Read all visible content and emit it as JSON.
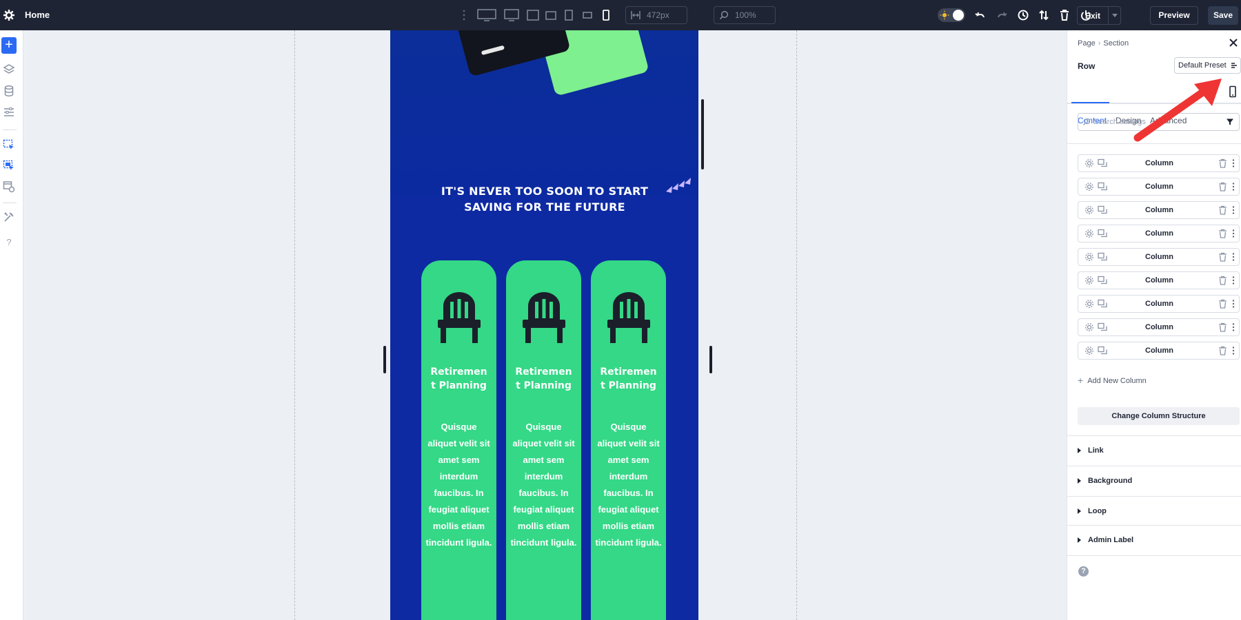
{
  "topbar": {
    "page_name": "Home",
    "width_value": "472px",
    "zoom_value": "100%",
    "exit_label": "Exit",
    "preview_label": "Preview",
    "save_label": "Save",
    "icons": [
      "settings-icon",
      "more-vertical-icon",
      "desktop-wide-icon",
      "desktop-icon",
      "laptop-icon",
      "tablet-landscape-icon",
      "tablet-icon",
      "phone-landscape-icon",
      "phone-icon",
      "width-icon",
      "zoom-icon",
      "theme-toggle",
      "undo-icon",
      "redo-icon",
      "history-icon",
      "sort-icon",
      "trash-icon",
      "power-icon"
    ]
  },
  "left_toolbar": {
    "help": "?",
    "icons": [
      "add-icon",
      "layers-icon",
      "database-icon",
      "sliders-icon",
      "select-icon",
      "multi-select-icon",
      "page-settings-icon",
      "tools-icon",
      "help-icon"
    ]
  },
  "canvas": {
    "headline": "IT'S NEVER TOO SOON TO START SAVING FOR THE FUTURE",
    "columns": [
      {
        "title": "Retiremen t Planning",
        "body": "Quisque aliquet velit sit amet sem interdum faucibus. In feugiat aliquet mollis etiam tincidunt ligula."
      },
      {
        "title": "Retiremen t Planning",
        "body": "Quisque aliquet velit sit amet sem interdum faucibus. In feugiat aliquet mollis etiam tincidunt ligula."
      },
      {
        "title": "Retiremen t Planning",
        "body": "Quisque aliquet velit sit amet sem interdum faucibus. In feugiat aliquet mollis etiam tincidunt ligula."
      }
    ],
    "colors": {
      "page_bg": "#0d2aa3",
      "column_bg": "#34d886",
      "accent_card": "#7ef08f"
    }
  },
  "panel": {
    "breadcrumb": [
      "Page",
      "Section"
    ],
    "element_label": "Row",
    "preset_label": "Default Preset",
    "tabs": [
      "Content",
      "Design",
      "Advanced"
    ],
    "active_tab": "Content",
    "search_placeholder": "Search settings",
    "column_label": "Column",
    "column_rows": [
      "Column",
      "Column",
      "Column",
      "Column",
      "Column",
      "Column",
      "Column",
      "Column",
      "Column"
    ],
    "add_column_label": "Add New Column",
    "change_structure_label": "Change Column Structure",
    "accordions": [
      "Link",
      "Background",
      "Loop",
      "Admin Label"
    ]
  },
  "colors": {
    "accent": "#2b6bf3",
    "topbar_bg": "#1e2433",
    "annotation": "#ef3434"
  }
}
